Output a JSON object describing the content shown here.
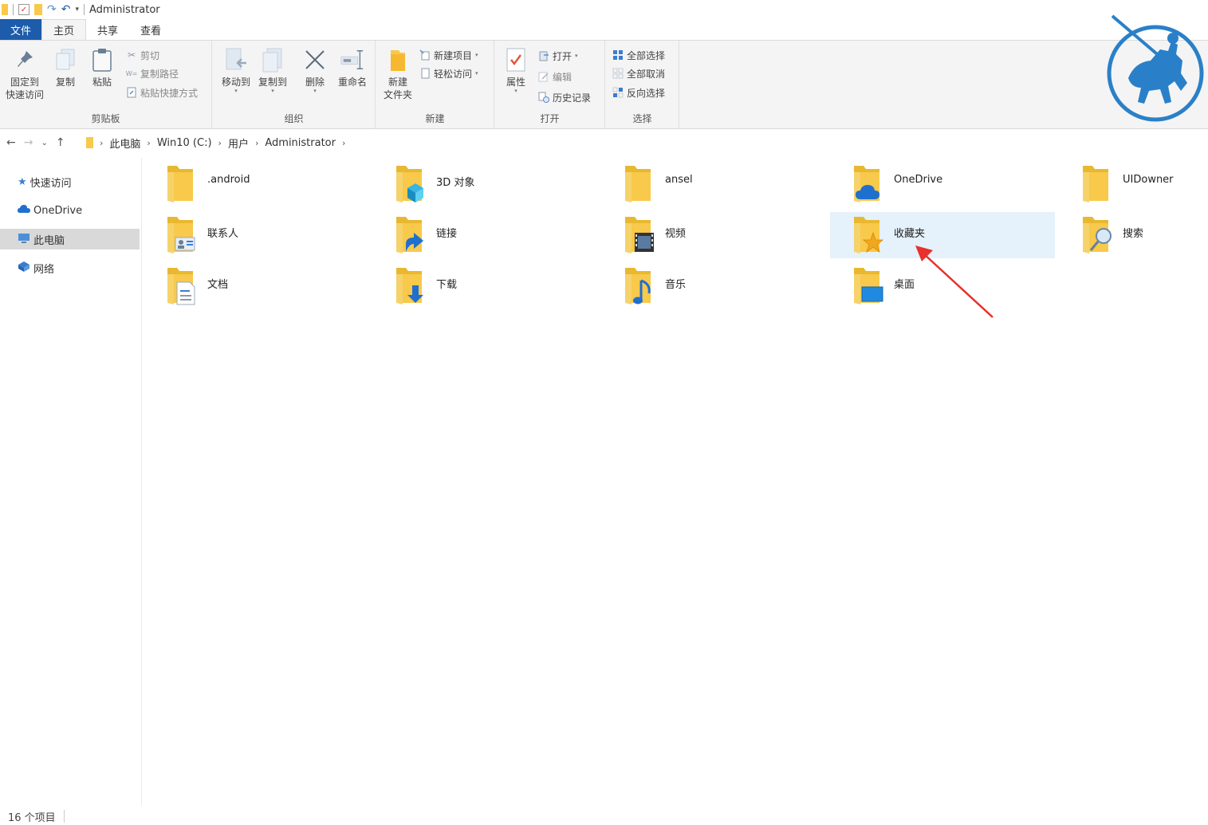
{
  "window": {
    "title": "Administrator"
  },
  "ribbon_tabs": [
    {
      "label": "文件"
    },
    {
      "label": "主页"
    },
    {
      "label": "共享"
    },
    {
      "label": "查看"
    }
  ],
  "ribbon": {
    "clipboard": {
      "label": "剪贴板",
      "pin": "固定到\n快速访问",
      "copy": "复制",
      "paste": "粘贴",
      "cut": "剪切",
      "copy_path": "复制路径",
      "paste_shortcut": "粘贴快捷方式"
    },
    "organize": {
      "label": "组织",
      "move_to": "移动到",
      "copy_to": "复制到",
      "delete": "删除",
      "rename": "重命名"
    },
    "new": {
      "label": "新建",
      "new_folder": "新建\n文件夹",
      "new_item": "新建项目",
      "easy_access": "轻松访问"
    },
    "open": {
      "label": "打开",
      "properties": "属性",
      "open": "打开",
      "edit": "编辑",
      "history": "历史记录"
    },
    "select": {
      "label": "选择",
      "select_all": "全部选择",
      "select_none": "全部取消",
      "invert": "反向选择"
    }
  },
  "breadcrumb": [
    "此电脑",
    "Win10 (C:)",
    "用户",
    "Administrator"
  ],
  "nav_pane": [
    {
      "label": "快速访问",
      "icon": "star-icon"
    },
    {
      "label": "OneDrive",
      "icon": "cloud-icon"
    },
    {
      "label": "此电脑",
      "icon": "computer-icon"
    },
    {
      "label": "网络",
      "icon": "network-icon"
    }
  ],
  "items": [
    {
      "name": ".android",
      "icon": "folder"
    },
    {
      "name": "3D 对象",
      "icon": "3d-objects"
    },
    {
      "name": "ansel",
      "icon": "folder"
    },
    {
      "name": "OneDrive",
      "icon": "onedrive"
    },
    {
      "name": "UIDowner",
      "icon": "folder"
    },
    {
      "name": "联系人",
      "icon": "contacts"
    },
    {
      "name": "链接",
      "icon": "links"
    },
    {
      "name": "视频",
      "icon": "videos"
    },
    {
      "name": "收藏夹",
      "icon": "favorites"
    },
    {
      "name": "搜索",
      "icon": "searches"
    },
    {
      "name": "文档",
      "icon": "documents"
    },
    {
      "name": "下载",
      "icon": "downloads"
    },
    {
      "name": "音乐",
      "icon": "music"
    },
    {
      "name": "桌面",
      "icon": "desktop"
    }
  ],
  "status": {
    "count": "16 个项目"
  },
  "colors": {
    "file_tab": "#1c5cab",
    "folder": "#f8c94a",
    "hover": "#e5f1fb",
    "annotation_arrow": "#e8302c",
    "logo": "#2a80c8"
  }
}
